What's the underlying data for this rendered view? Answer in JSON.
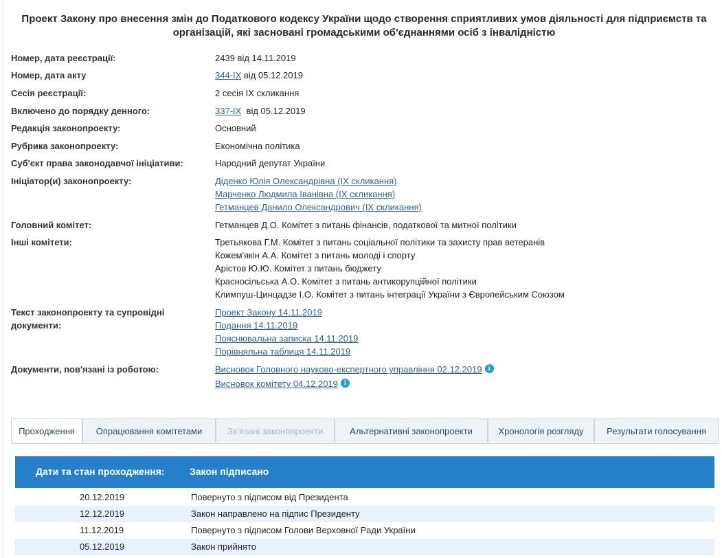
{
  "title_line1": "Проект Закону про внесення змін до Податкового кодексу України щодо створення сприятливих умов діяльності для підприємств та",
  "title_line2": "організацій, які засновані громадськими об'єднаннями осіб з інвалідністю",
  "fields": {
    "reg": {
      "label": "Номер, дата реєстрації:",
      "value": "2439 від 14.11.2019"
    },
    "act": {
      "label": "Номер, дата акту",
      "link": "344-IX",
      "rest": " від 05.12.2019"
    },
    "session": {
      "label": "Сесія реєстрації:",
      "value": "2 сесія IX скликання"
    },
    "agenda": {
      "label": "Включено до порядку денного:",
      "link": "337-IX",
      "rest": "  від 05.12.2019"
    },
    "edition": {
      "label": "Редакція законопроекту:",
      "value": "Основний"
    },
    "rubric": {
      "label": "Рубрика законопроекту:",
      "value": "Економічна політика"
    },
    "subject": {
      "label": "Суб'єкт права законодавчої ініціативи:",
      "value": "Народний депутат України"
    },
    "initiators": {
      "label": "Ініціатор(и) законопроекту:",
      "items": [
        "Діденко Юлія Олександрівна (IX скликання)",
        "Марченко Людмила Іванівна (IX скликання)",
        "Гетманцев Данило Олександрович (IX скликання)"
      ]
    },
    "main_committee": {
      "label": "Головний комітет:",
      "value": "Гетманцев Д.О. Комітет з питань фінансів, податкової та митної політики"
    },
    "other_committees": {
      "label": "Інші комітети:",
      "items": [
        "Третьякова Г.М. Комітет з питань соціальної політики та захисту прав ветеранів",
        "Кожем'якін А.А. Комітет з питань молоді і спорту",
        "Арістов Ю.Ю. Комітет з питань бюджету",
        "Красносільська А.О. Комітет з питань антикорупційної політики",
        "Климпуш-Цинцадзе І.О. Комітет з питань інтеграції України з Європейським Союзом"
      ]
    },
    "texts": {
      "label_line1": "Текст законопроекту та супровідні",
      "label_line2": "документи:",
      "items": [
        "Проект Закону 14.11.2019",
        "Подання 14.11.2019",
        "Пояснювальна записка 14.11.2019",
        "Порівняльна таблиця 14.11.2019"
      ]
    },
    "docs": {
      "label": "Документи, пов'язані із роботою:",
      "items": [
        "Висновок Головного науково-експертного управління 02.12.2019",
        "Висновок комітету 04.12.2019"
      ],
      "info_icon": "i"
    }
  },
  "tabs": [
    "Проходження",
    "Опрацювання комітетами",
    "Зв'язані законопроекти",
    "Альтернативні законопроекти",
    "Хронологія розгляду",
    "Результати голосування"
  ],
  "status_bar": {
    "label": "Дати та стан проходження:",
    "value": "Закон підписано"
  },
  "history": [
    {
      "date": "20.12.2019",
      "event": "Повернуто з підписом від Президента"
    },
    {
      "date": "12.12.2019",
      "event": "Закон направлено на підпис Президенту"
    },
    {
      "date": "11.12.2019",
      "event": "Повернуто з підписом Голови Верховної Ради України"
    },
    {
      "date": "05.12.2019",
      "event": "Закон прийнято"
    }
  ],
  "colors": {
    "accent": "#2580c9",
    "link": "#2f5f9c",
    "row_alt": "#e9f1fb",
    "info_icon": "#1f9bd8"
  }
}
